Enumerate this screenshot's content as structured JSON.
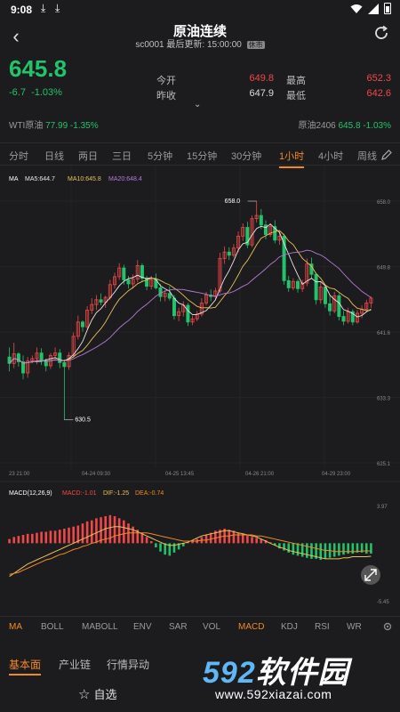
{
  "status": {
    "time": "9:08",
    "download_icons": [
      "download-icon",
      "download-icon"
    ]
  },
  "nav": {
    "title": "原油连续",
    "code": "sc0001",
    "updated_label": "最后更新:",
    "updated_time": "15:00:00",
    "badge": "休市"
  },
  "quote": {
    "price": "645.8",
    "change": "-6.7",
    "change_pct": "-1.03%",
    "open_label": "今开",
    "open": "649.8",
    "prev_close_label": "昨收",
    "prev_close": "647.9",
    "high_label": "最高",
    "high": "652.3",
    "low_label": "最低",
    "low": "642.6",
    "wti_label": "WTI原油",
    "wti_value": "77.99",
    "wti_pct": "-1.35%",
    "c2406_label": "原油2406",
    "c2406_value": "645.8",
    "c2406_pct": "-1.03%"
  },
  "colors": {
    "up": "#f04848",
    "down": "#22c36a",
    "accent": "#f08a24",
    "ma5": "#e8e8e8",
    "ma10": "#e8c15a",
    "ma20": "#b57ad6",
    "dif": "#e8c15a",
    "dea": "#f08a24"
  },
  "periods": [
    "分时",
    "日线",
    "两日",
    "三日",
    "5分钟",
    "15分钟",
    "30分钟",
    "1小时",
    "4小时",
    "周线"
  ],
  "active_period": 7,
  "legend": {
    "ma": "MA",
    "ma5": "MA5:644.7",
    "ma10": "MA10:645.8",
    "ma20": "MA20:648.4"
  },
  "macd_legend": {
    "name": "MACD(12,26,9)",
    "macd": "MACD:-1.01",
    "dif": "DIF:-1.25",
    "dea": "DEA:-0.74"
  },
  "chart_data": {
    "type": "candlestick",
    "y_ticks": [
      "658.0",
      "649.8",
      "641.6",
      "633.3",
      "625.1"
    ],
    "ylim": [
      625.1,
      658.0
    ],
    "x_ticks": [
      "23 21:00",
      "04-24 09:30",
      "04-25 13:45",
      "04-26 21:00",
      "04-29 23:00"
    ],
    "max_annotation": "658.0",
    "min_annotation": "630.5",
    "candles": [
      [
        638.4,
        639.6,
        636.6,
        637.6
      ],
      [
        637.6,
        640.2,
        637.0,
        638.8
      ],
      [
        638.8,
        639.0,
        637.2,
        637.8
      ],
      [
        637.8,
        638.6,
        635.6,
        636.4
      ],
      [
        636.4,
        638.4,
        635.8,
        637.9
      ],
      [
        637.9,
        638.6,
        637.6,
        638.2
      ],
      [
        638.2,
        639.6,
        637.5,
        638.9
      ],
      [
        638.9,
        639.5,
        637.4,
        637.9
      ],
      [
        637.9,
        638.2,
        636.6,
        637.3
      ],
      [
        637.3,
        638.9,
        636.9,
        638.6
      ],
      [
        638.6,
        639.6,
        638.2,
        638.9
      ],
      [
        638.9,
        639.4,
        637.0,
        637.7
      ],
      [
        637.7,
        638.1,
        630.5,
        637.2
      ],
      [
        637.2,
        639.0,
        636.8,
        638.6
      ],
      [
        638.6,
        641.5,
        638.3,
        641.0
      ],
      [
        641.0,
        643.6,
        640.6,
        642.8
      ],
      [
        642.8,
        643.0,
        641.6,
        642.2
      ],
      [
        642.2,
        644.8,
        641.9,
        644.3
      ],
      [
        644.3,
        645.8,
        643.8,
        645.0
      ],
      [
        645.0,
        646.2,
        644.3,
        645.6
      ],
      [
        645.6,
        646.4,
        644.9,
        645.3
      ],
      [
        645.3,
        646.1,
        644.6,
        645.9
      ],
      [
        645.9,
        648.1,
        645.6,
        647.5
      ],
      [
        647.5,
        649.0,
        647.0,
        648.5
      ],
      [
        648.5,
        650.2,
        648.1,
        649.6
      ],
      [
        649.6,
        650.0,
        647.5,
        648.1
      ],
      [
        648.1,
        648.6,
        647.0,
        647.6
      ],
      [
        647.6,
        648.8,
        647.0,
        648.2
      ],
      [
        648.2,
        650.6,
        647.8,
        649.9
      ],
      [
        649.9,
        650.2,
        647.8,
        648.3
      ],
      [
        648.3,
        648.6,
        646.8,
        647.3
      ],
      [
        647.3,
        648.6,
        646.9,
        648.1
      ],
      [
        648.1,
        648.9,
        646.9,
        647.1
      ],
      [
        647.1,
        647.6,
        645.4,
        646.0
      ],
      [
        646.0,
        646.8,
        645.4,
        646.4
      ],
      [
        646.4,
        647.3,
        645.5,
        645.8
      ],
      [
        645.8,
        646.2,
        643.1,
        643.6
      ],
      [
        643.6,
        644.6,
        642.9,
        644.1
      ],
      [
        644.1,
        645.4,
        643.5,
        644.9
      ],
      [
        644.9,
        645.2,
        642.3,
        642.8
      ],
      [
        642.8,
        643.6,
        642.4,
        643.2
      ],
      [
        643.2,
        644.2,
        642.9,
        643.8
      ],
      [
        643.8,
        645.8,
        643.5,
        645.2
      ],
      [
        645.2,
        646.6,
        644.9,
        646.2
      ],
      [
        646.2,
        646.9,
        645.4,
        646.0
      ],
      [
        646.0,
        647.1,
        645.6,
        646.7
      ],
      [
        646.7,
        651.5,
        646.4,
        650.8
      ],
      [
        650.8,
        652.3,
        650.1,
        651.6
      ],
      [
        651.6,
        652.2,
        650.6,
        651.2
      ],
      [
        651.2,
        652.6,
        650.9,
        652.1
      ],
      [
        652.1,
        654.2,
        651.6,
        653.6
      ],
      [
        653.6,
        655.2,
        653.0,
        654.7
      ],
      [
        654.7,
        655.4,
        652.1,
        652.5
      ],
      [
        652.5,
        656.2,
        652.2,
        655.8
      ],
      [
        655.8,
        658.0,
        655.3,
        656.2
      ],
      [
        656.2,
        657.0,
        654.5,
        655.0
      ],
      [
        655.0,
        655.6,
        653.2,
        653.8
      ],
      [
        653.8,
        655.2,
        653.5,
        654.8
      ],
      [
        654.8,
        655.6,
        652.7,
        653.1
      ],
      [
        653.1,
        654.2,
        652.5,
        653.6
      ],
      [
        653.6,
        653.9,
        647.5,
        648.0
      ],
      [
        648.0,
        648.6,
        646.6,
        647.1
      ],
      [
        647.1,
        648.3,
        646.8,
        647.9
      ],
      [
        647.9,
        648.2,
        646.5,
        647.0
      ],
      [
        647.0,
        648.1,
        646.6,
        647.7
      ],
      [
        647.7,
        650.8,
        647.3,
        650.1
      ],
      [
        650.1,
        650.9,
        648.2,
        648.8
      ],
      [
        648.8,
        649.0,
        645.0,
        645.6
      ],
      [
        645.6,
        647.8,
        645.1,
        647.2
      ],
      [
        647.2,
        647.5,
        644.6,
        645.1
      ],
      [
        645.1,
        646.1,
        643.6,
        644.2
      ],
      [
        644.2,
        646.6,
        643.9,
        646.1
      ],
      [
        646.1,
        646.4,
        643.0,
        643.5
      ],
      [
        643.5,
        644.2,
        642.4,
        642.9
      ],
      [
        642.9,
        644.6,
        642.6,
        644.1
      ],
      [
        644.1,
        644.4,
        642.4,
        642.8
      ],
      [
        642.8,
        644.3,
        642.6,
        643.9
      ],
      [
        643.9,
        644.9,
        643.3,
        644.4
      ],
      [
        644.4,
        645.6,
        644.1,
        645.2
      ],
      [
        645.2,
        646.0,
        644.6,
        645.8
      ]
    ],
    "macd_ylim": [
      -5.45,
      3.97
    ],
    "macd_ticks": [
      "3.97",
      "-5.45"
    ],
    "macd_hist": [
      0.4,
      0.6,
      0.7,
      0.8,
      0.9,
      0.9,
      1.0,
      1.1,
      1.1,
      1.2,
      1.2,
      1.3,
      1.4,
      1.5,
      1.6,
      1.7,
      1.9,
      2.1,
      2.2,
      2.4,
      2.5,
      2.6,
      2.7,
      2.6,
      2.4,
      2.2,
      1.9,
      1.6,
      1.3,
      1.0,
      0.6,
      0.2,
      -0.4,
      -0.8,
      -1.1,
      -1.2,
      -0.9,
      -0.6,
      -0.3,
      0.1,
      0.3,
      0.4,
      0.6,
      0.8,
      1.0,
      1.2,
      1.3,
      1.4,
      1.3,
      1.2,
      1.0,
      0.9,
      0.8,
      0.6,
      0.5,
      0.4,
      0.3,
      0.1,
      -0.2,
      -0.5,
      -0.7,
      -0.9,
      -1.1,
      -1.2,
      -1.3,
      -1.4,
      -1.5,
      -1.5,
      -1.6,
      -1.5,
      -1.4,
      -1.3,
      -1.2,
      -1.1,
      -1.0,
      -1.0,
      -0.9,
      -0.9,
      -1.0,
      -1.0
    ],
    "dif": [
      -3.2,
      -2.9,
      -2.6,
      -2.3,
      -2.0,
      -1.8,
      -1.6,
      -1.4,
      -1.2,
      -1.0,
      -0.8,
      -0.6,
      -0.4,
      -0.2,
      0.0,
      0.2,
      0.4,
      0.6,
      0.8,
      1.0,
      1.2,
      1.4,
      1.5,
      1.6,
      1.6,
      1.5,
      1.4,
      1.3,
      1.1,
      0.9,
      0.7,
      0.5,
      0.3,
      0.1,
      -0.1,
      -0.2,
      -0.2,
      -0.1,
      0.0,
      0.1,
      0.3,
      0.5,
      0.7,
      0.8,
      0.9,
      1.0,
      1.1,
      1.2,
      1.2,
      1.1,
      1.0,
      0.9,
      0.8,
      0.7,
      0.6,
      0.4,
      0.2,
      0.0,
      -0.2,
      -0.4,
      -0.5,
      -0.7,
      -0.8,
      -0.9,
      -1.0,
      -1.1,
      -1.2,
      -1.3,
      -1.4,
      -1.5,
      -1.5,
      -1.5,
      -1.5,
      -1.4,
      -1.4,
      -1.3,
      -1.3,
      -1.3,
      -1.3,
      -1.25
    ],
    "dea": [
      -3.0,
      -2.9,
      -2.8,
      -2.6,
      -2.4,
      -2.2,
      -2.0,
      -1.8,
      -1.6,
      -1.5,
      -1.3,
      -1.1,
      -1.0,
      -0.8,
      -0.6,
      -0.5,
      -0.3,
      -0.2,
      0.0,
      0.1,
      0.3,
      0.4,
      0.5,
      0.7,
      0.8,
      0.9,
      1.0,
      1.0,
      1.0,
      1.0,
      1.0,
      0.9,
      0.8,
      0.7,
      0.6,
      0.5,
      0.4,
      0.3,
      0.2,
      0.2,
      0.2,
      0.2,
      0.3,
      0.3,
      0.4,
      0.5,
      0.6,
      0.7,
      0.7,
      0.8,
      0.8,
      0.8,
      0.8,
      0.8,
      0.7,
      0.7,
      0.6,
      0.5,
      0.4,
      0.3,
      0.2,
      0.1,
      0.0,
      -0.1,
      -0.2,
      -0.3,
      -0.4,
      -0.5,
      -0.6,
      -0.7,
      -0.7,
      -0.8,
      -0.8,
      -0.8,
      -0.8,
      -0.8,
      -0.8,
      -0.75,
      -0.74,
      -0.74
    ]
  },
  "indicators": [
    "MA",
    "BOLL",
    "MABOLL",
    "ENV",
    "SAR",
    "VOL",
    "MACD",
    "KDJ",
    "RSI",
    "WR"
  ],
  "active_indicators": [
    0,
    6
  ],
  "bottom_tabs": [
    "基本面",
    "产业链",
    "行情异动"
  ],
  "active_bottom_tab": 0,
  "favorite_label": "自选",
  "logo": {
    "brand_num": "592",
    "brand_text": "软件园",
    "url": "www.592xiazai.com"
  }
}
